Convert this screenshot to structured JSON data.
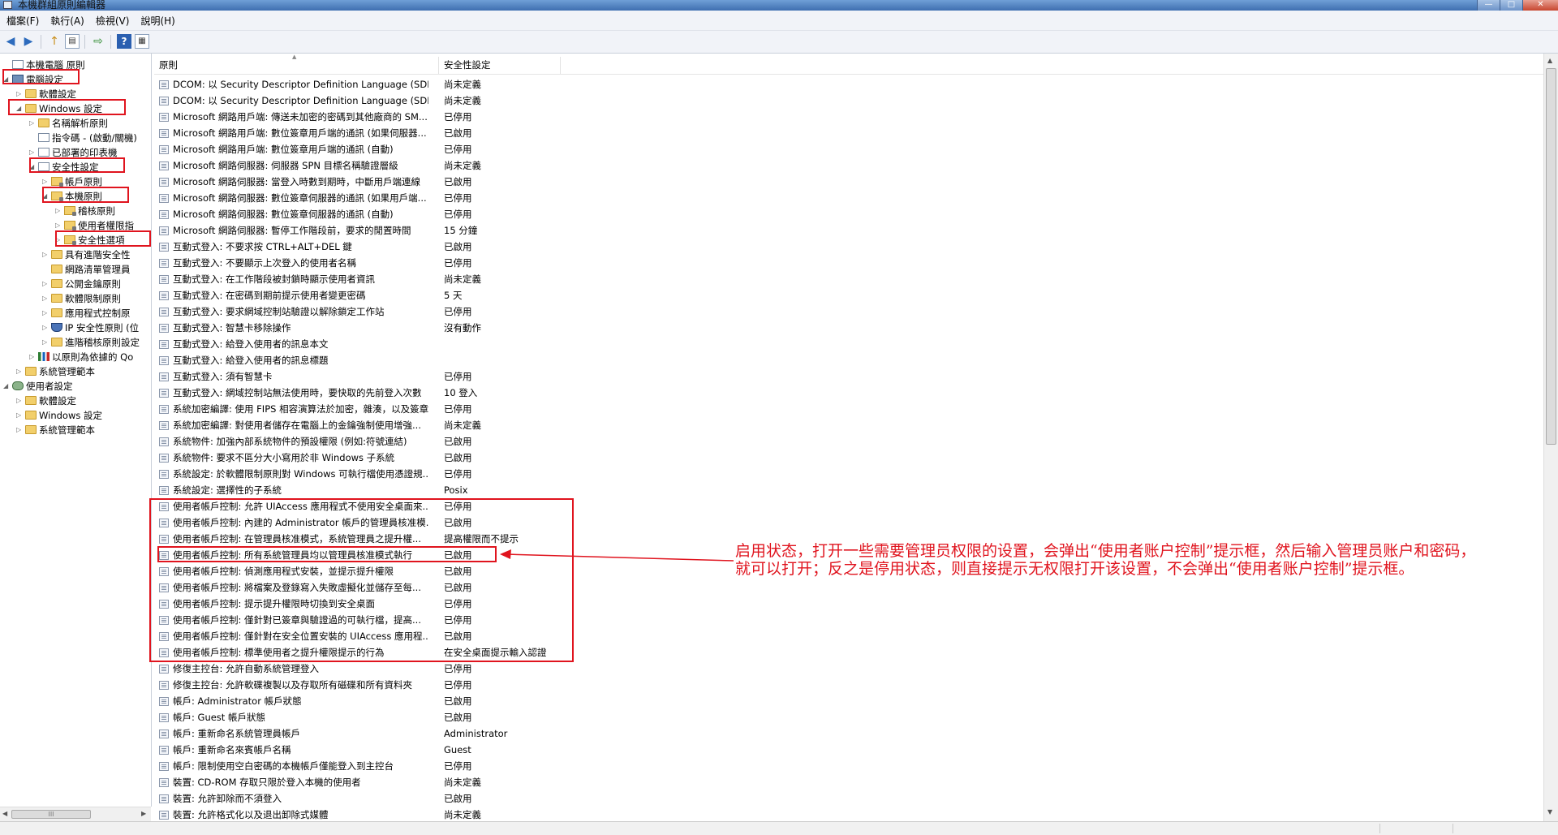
{
  "window": {
    "title": "本機群組原則編輯器",
    "controls": [
      "—",
      "□",
      "✕"
    ]
  },
  "menu": [
    "檔案(F)",
    "執行(A)",
    "檢視(V)",
    "說明(H)"
  ],
  "toolbar": {
    "back": "◀",
    "forward": "▶",
    "up": "↑",
    "show_hide_tree": "▤",
    "export": "⇨",
    "help": "?",
    "properties": "▦"
  },
  "tree": [
    {
      "label": "本機電腦 原則",
      "icon": "doc-icon",
      "level": 0,
      "exp": ""
    },
    {
      "label": "電腦設定",
      "icon": "computer-icon",
      "level": 0,
      "exp": "◢"
    },
    {
      "label": "軟體設定",
      "icon": "folder-icon",
      "level": 1,
      "exp": "▷"
    },
    {
      "label": "Windows 設定",
      "icon": "folder-icon",
      "level": 1,
      "exp": "◢"
    },
    {
      "label": "名稱解析原則",
      "icon": "folder-icon",
      "level": 2,
      "exp": "▷"
    },
    {
      "label": "指令碼 - (啟動/關機)",
      "icon": "doc-icon",
      "level": 2,
      "exp": ""
    },
    {
      "label": "已部署的印表機",
      "icon": "doc-icon",
      "level": 2,
      "exp": "▷"
    },
    {
      "label": "安全性設定",
      "icon": "doc-icon",
      "level": 2,
      "exp": "◢"
    },
    {
      "label": "帳戶原則",
      "icon": "lock-folder-icon",
      "level": 3,
      "exp": "▷"
    },
    {
      "label": "本機原則",
      "icon": "lock-folder-icon",
      "level": 3,
      "exp": "◢"
    },
    {
      "label": "稽核原則",
      "icon": "lock-folder-icon",
      "level": 4,
      "exp": "▷"
    },
    {
      "label": "使用者權限指",
      "icon": "lock-folder-icon",
      "level": 4,
      "exp": "▷"
    },
    {
      "label": "安全性選項",
      "icon": "lock-folder-icon",
      "level": 4,
      "exp": "▷"
    },
    {
      "label": "具有進階安全性",
      "icon": "folder-icon",
      "level": 3,
      "exp": "▷"
    },
    {
      "label": "網路清單管理員",
      "icon": "folder-icon",
      "level": 3,
      "exp": ""
    },
    {
      "label": "公開金鑰原則",
      "icon": "folder-icon",
      "level": 3,
      "exp": "▷"
    },
    {
      "label": "軟體限制原則",
      "icon": "folder-icon",
      "level": 3,
      "exp": "▷"
    },
    {
      "label": "應用程式控制原",
      "icon": "folder-icon",
      "level": 3,
      "exp": "▷"
    },
    {
      "label": "IP 安全性原則 (位",
      "icon": "shield-icon",
      "level": 3,
      "exp": "▷"
    },
    {
      "label": "進階稽核原則設定",
      "icon": "folder-icon",
      "level": 3,
      "exp": "▷"
    },
    {
      "label": "以原則為依據的 Qo",
      "icon": "chart-icon",
      "level": 2,
      "exp": "▷"
    },
    {
      "label": "系統管理範本",
      "icon": "folder-icon",
      "level": 1,
      "exp": "▷"
    },
    {
      "label": "使用者設定",
      "icon": "users-icon",
      "level": 0,
      "exp": "◢"
    },
    {
      "label": "軟體設定",
      "icon": "folder-icon",
      "level": 1,
      "exp": "▷"
    },
    {
      "label": "Windows 設定",
      "icon": "folder-icon",
      "level": 1,
      "exp": "▷"
    },
    {
      "label": "系統管理範本",
      "icon": "folder-icon",
      "level": 1,
      "exp": "▷"
    }
  ],
  "tree_scroll_thumb": "III",
  "columns": [
    "原則",
    "安全性設定"
  ],
  "rows": [
    [
      "DCOM: 以 Security Descriptor Definition Language (SDD...",
      "尚未定義"
    ],
    [
      "DCOM: 以 Security Descriptor Definition Language (SDD...",
      "尚未定義"
    ],
    [
      "Microsoft 網路用戶端: 傳送未加密的密碼到其他廠商的 SM...",
      "已停用"
    ],
    [
      "Microsoft 網路用戶端: 數位簽章用戶端的通訊 (如果伺服器...",
      "已啟用"
    ],
    [
      "Microsoft 網路用戶端: 數位簽章用戶端的通訊 (自動)",
      "已停用"
    ],
    [
      "Microsoft 網路伺服器: 伺服器 SPN 目標名稱驗證層級",
      "尚未定義"
    ],
    [
      "Microsoft 網路伺服器: 當登入時數到期時，中斷用戶端連線",
      "已啟用"
    ],
    [
      "Microsoft 網路伺服器: 數位簽章伺服器的通訊 (如果用戶端...",
      "已停用"
    ],
    [
      "Microsoft 網路伺服器: 數位簽章伺服器的通訊 (自動)",
      "已停用"
    ],
    [
      "Microsoft 網路伺服器: 暫停工作階段前，要求的閒置時間",
      "15 分鐘"
    ],
    [
      "互動式登入: 不要求按 CTRL+ALT+DEL 鍵",
      "已啟用"
    ],
    [
      "互動式登入: 不要顯示上次登入的使用者名稱",
      "已停用"
    ],
    [
      "互動式登入: 在工作階段被封鎖時顯示使用者資訊",
      "尚未定義"
    ],
    [
      "互動式登入: 在密碼到期前提示使用者變更密碼",
      "5 天"
    ],
    [
      "互動式登入: 要求網域控制站驗證以解除鎖定工作站",
      "已停用"
    ],
    [
      "互動式登入: 智慧卡移除操作",
      "沒有動作"
    ],
    [
      "互動式登入: 給登入使用者的訊息本文",
      ""
    ],
    [
      "互動式登入: 給登入使用者的訊息標題",
      ""
    ],
    [
      "互動式登入: 須有智慧卡",
      "已停用"
    ],
    [
      "互動式登入: 網域控制站無法使用時，要快取的先前登入次數",
      "10 登入"
    ],
    [
      "系統加密編譯: 使用 FIPS 相容演算法於加密，雜湊，以及簽章",
      "已停用"
    ],
    [
      "系統加密編譯: 對使用者儲存在電腦上的金鑰強制使用增強...",
      "尚未定義"
    ],
    [
      "系統物件: 加強內部系統物件的預設權限 (例如:符號連結)",
      "已啟用"
    ],
    [
      "系統物件: 要求不區分大小寫用於非 Windows 子系統",
      "已啟用"
    ],
    [
      "系統設定: 於軟體限制原則對 Windows 可執行檔使用憑證規...",
      "已停用"
    ],
    [
      "系統設定: 選擇性的子系統",
      "Posix"
    ],
    [
      "使用者帳戶控制: 允許 UIAccess 應用程式不使用安全桌面來...",
      "已停用"
    ],
    [
      "使用者帳戶控制: 內建的 Administrator 帳戶的管理員核准模...",
      "已啟用"
    ],
    [
      "使用者帳戶控制: 在管理員核准模式，系統管理員之提升權...",
      "提高權限而不提示"
    ],
    [
      "使用者帳戶控制: 所有系統管理員均以管理員核准模式執行",
      "已啟用"
    ],
    [
      "使用者帳戶控制: 偵測應用程式安裝，並提示提升權限",
      "已啟用"
    ],
    [
      "使用者帳戶控制: 將檔案及登錄寫入失敗虛擬化並儲存至每...",
      "已啟用"
    ],
    [
      "使用者帳戶控制: 提示提升權限時切換到安全桌面",
      "已停用"
    ],
    [
      "使用者帳戶控制: 僅針對已簽章與驗證過的可執行檔，提高...",
      "已停用"
    ],
    [
      "使用者帳戶控制: 僅針對在安全位置安裝的 UIAccess 應用程...",
      "已啟用"
    ],
    [
      "使用者帳戶控制: 標準使用者之提升權限提示的行為",
      "在安全桌面提示輸入認證"
    ],
    [
      "修復主控台: 允許自動系統管理登入",
      "已停用"
    ],
    [
      "修復主控台: 允許軟碟複製以及存取所有磁碟和所有資料夾",
      "已停用"
    ],
    [
      "帳戶: Administrator 帳戶狀態",
      "已啟用"
    ],
    [
      "帳戶: Guest 帳戶狀態",
      "已啟用"
    ],
    [
      "帳戶: 重新命名系統管理員帳戶",
      "Administrator"
    ],
    [
      "帳戶: 重新命名來賓帳戶名稱",
      "Guest"
    ],
    [
      "帳戶: 限制使用空白密碼的本機帳戶僅能登入到主控台",
      "已停用"
    ],
    [
      "裝置: CD-ROM 存取只限於登入本機的使用者",
      "尚未定義"
    ],
    [
      "裝置: 允許卸除而不須登入",
      "已啟用"
    ],
    [
      "裝置: 允許格式化以及退出卸除式媒體",
      "尚未定義"
    ]
  ],
  "annotation": {
    "text": "启用状态，打开一些需要管理员权限的设置，会弹出“使用者账户控制”提示框，然后输入管理员账户和密码，就可以打开；反之是停用状态，则直接提示无权限打开该设置，不会弹出“使用者账户控制”提示框。",
    "color": "#e0141e"
  }
}
